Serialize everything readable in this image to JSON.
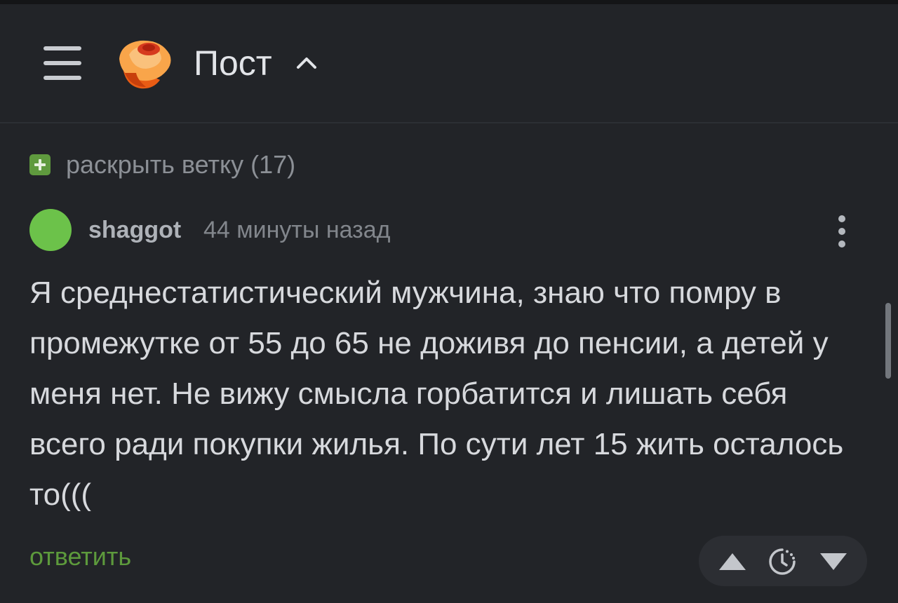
{
  "header": {
    "menu_icon": "hamburger-menu-icon",
    "logo_icon": "pikabu-logo-icon",
    "title": "Пост",
    "title_caret_icon": "chevron-up-icon"
  },
  "thread": {
    "expand_label": "раскрыть ветку (17)",
    "expand_icon": "plus-icon"
  },
  "comment": {
    "author": "shaggot",
    "timestamp": "44 минуты назад",
    "text": "Я среднестатистический мужчина, знаю что помру в промежутке от 55 до 65 не доживя до пенсии, а детей у меня нет. Не вижу смысла горбатится и лишать себя всего ради покупки жилья. По сути лет 15 жить осталось то(((",
    "reply_label": "ответить",
    "more_icon": "vertical-dots-icon",
    "avatar_color": "#6cc24a"
  },
  "voting": {
    "upvote_icon": "triangle-up-icon",
    "save_icon": "clock-icon",
    "downvote_icon": "triangle-down-icon"
  },
  "colors": {
    "background": "#222428",
    "accent_green": "#5f9a3e",
    "text_primary": "#d7d9dd",
    "text_muted": "#8c9096"
  }
}
